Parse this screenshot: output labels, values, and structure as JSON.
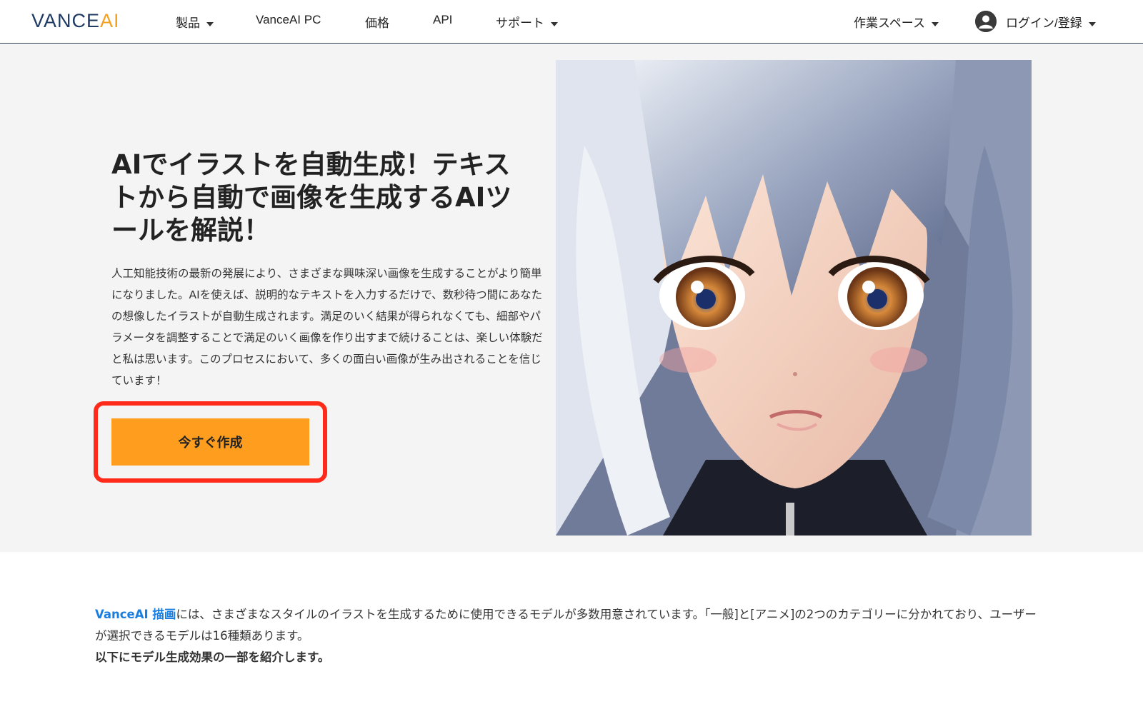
{
  "header": {
    "logo_left": "VANCE",
    "logo_right": "AI",
    "nav": {
      "products": "製品",
      "pc": "VanceAI PC",
      "pricing": "価格",
      "api": "API",
      "support": "サポート"
    },
    "workspace": "作業スペース",
    "login": "ログイン/登録"
  },
  "hero": {
    "title": "AIでイラストを自動生成！テキストから自動で画像を生成するAIツールを解説！",
    "description": "人工知能技術の最新の発展により、さまざまな興味深い画像を生成することがより簡単になりました。AIを使えば、説明的なテキストを入力するだけで、数秒待つ間にあなたの想像したイラストが自動生成されます。満足のいく結果が得られなくても、細部やパラメータを調整することで満足のいく画像を作り出すまで続けることは、楽しい体験だと私は思います。このプロセスにおいて、多くの面白い画像が生み出されることを信じています！",
    "cta_label": "今すぐ作成"
  },
  "intro": {
    "link_text": "VanceAI 描画",
    "text_1": "には、さまざまなスタイルのイラストを生成するために使用できるモデルが多数用意されています。「一般]と[アニメ]の2つのカテゴリーに分かれており、ユーザーが選択できるモデルは16種類あります。",
    "text_bold": "以下にモデル生成効果の一部を紹介します。"
  },
  "colors": {
    "brand_navy": "#1f3b64",
    "brand_orange": "#f5a020",
    "cta": "#ff9e1e",
    "highlight": "#ff2a1a",
    "link": "#1a7de0"
  }
}
